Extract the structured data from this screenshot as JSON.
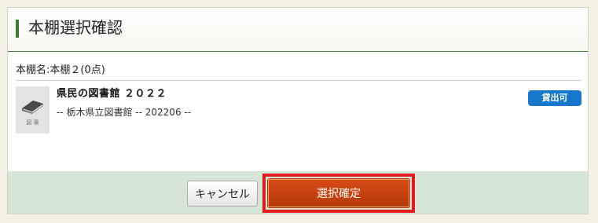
{
  "dialog": {
    "title": "本棚選択確認"
  },
  "shelf": {
    "name_line": "本棚名:本棚２(0点)"
  },
  "book": {
    "title": "県民の図書館 ２０２２",
    "meta": "-- 栃木県立図書館 -- 202206 --",
    "thumb_label": "図 書",
    "thumb_icon": "book-icon",
    "status": "貸出可"
  },
  "buttons": {
    "cancel": "キャンセル",
    "confirm": "選択確定"
  },
  "colors": {
    "accent_green": "#3b7a3b",
    "status_blue": "#1677cc",
    "confirm_orange": "#c4420e",
    "highlight_red": "#e3191e",
    "footer_green": "#d6e6d6"
  }
}
